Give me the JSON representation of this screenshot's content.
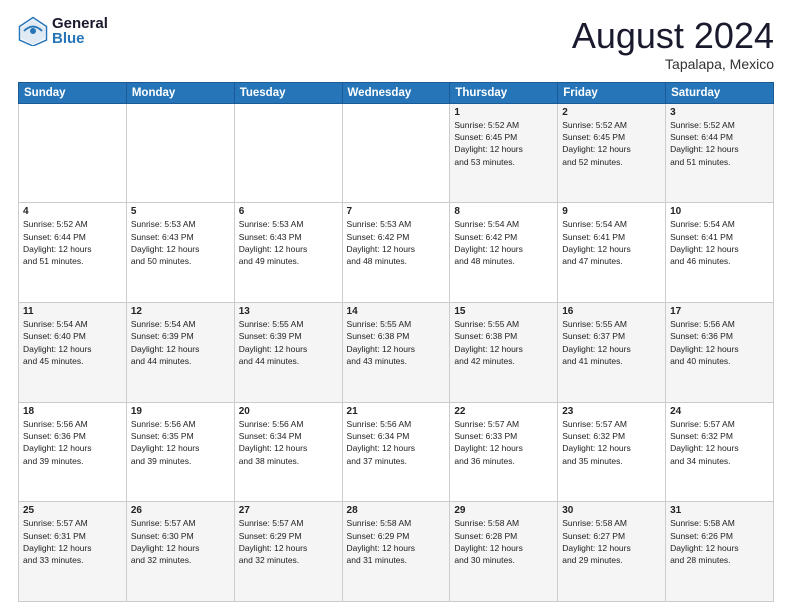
{
  "header": {
    "logo_general": "General",
    "logo_blue": "Blue",
    "month_title": "August 2024",
    "location": "Tapalapa, Mexico"
  },
  "days_of_week": [
    "Sunday",
    "Monday",
    "Tuesday",
    "Wednesday",
    "Thursday",
    "Friday",
    "Saturday"
  ],
  "weeks": [
    {
      "days": [
        {
          "number": "",
          "info": ""
        },
        {
          "number": "",
          "info": ""
        },
        {
          "number": "",
          "info": ""
        },
        {
          "number": "",
          "info": ""
        },
        {
          "number": "1",
          "info": "Sunrise: 5:52 AM\nSunset: 6:45 PM\nDaylight: 12 hours\nand 53 minutes."
        },
        {
          "number": "2",
          "info": "Sunrise: 5:52 AM\nSunset: 6:45 PM\nDaylight: 12 hours\nand 52 minutes."
        },
        {
          "number": "3",
          "info": "Sunrise: 5:52 AM\nSunset: 6:44 PM\nDaylight: 12 hours\nand 51 minutes."
        }
      ]
    },
    {
      "days": [
        {
          "number": "4",
          "info": "Sunrise: 5:52 AM\nSunset: 6:44 PM\nDaylight: 12 hours\nand 51 minutes."
        },
        {
          "number": "5",
          "info": "Sunrise: 5:53 AM\nSunset: 6:43 PM\nDaylight: 12 hours\nand 50 minutes."
        },
        {
          "number": "6",
          "info": "Sunrise: 5:53 AM\nSunset: 6:43 PM\nDaylight: 12 hours\nand 49 minutes."
        },
        {
          "number": "7",
          "info": "Sunrise: 5:53 AM\nSunset: 6:42 PM\nDaylight: 12 hours\nand 48 minutes."
        },
        {
          "number": "8",
          "info": "Sunrise: 5:54 AM\nSunset: 6:42 PM\nDaylight: 12 hours\nand 48 minutes."
        },
        {
          "number": "9",
          "info": "Sunrise: 5:54 AM\nSunset: 6:41 PM\nDaylight: 12 hours\nand 47 minutes."
        },
        {
          "number": "10",
          "info": "Sunrise: 5:54 AM\nSunset: 6:41 PM\nDaylight: 12 hours\nand 46 minutes."
        }
      ]
    },
    {
      "days": [
        {
          "number": "11",
          "info": "Sunrise: 5:54 AM\nSunset: 6:40 PM\nDaylight: 12 hours\nand 45 minutes."
        },
        {
          "number": "12",
          "info": "Sunrise: 5:54 AM\nSunset: 6:39 PM\nDaylight: 12 hours\nand 44 minutes."
        },
        {
          "number": "13",
          "info": "Sunrise: 5:55 AM\nSunset: 6:39 PM\nDaylight: 12 hours\nand 44 minutes."
        },
        {
          "number": "14",
          "info": "Sunrise: 5:55 AM\nSunset: 6:38 PM\nDaylight: 12 hours\nand 43 minutes."
        },
        {
          "number": "15",
          "info": "Sunrise: 5:55 AM\nSunset: 6:38 PM\nDaylight: 12 hours\nand 42 minutes."
        },
        {
          "number": "16",
          "info": "Sunrise: 5:55 AM\nSunset: 6:37 PM\nDaylight: 12 hours\nand 41 minutes."
        },
        {
          "number": "17",
          "info": "Sunrise: 5:56 AM\nSunset: 6:36 PM\nDaylight: 12 hours\nand 40 minutes."
        }
      ]
    },
    {
      "days": [
        {
          "number": "18",
          "info": "Sunrise: 5:56 AM\nSunset: 6:36 PM\nDaylight: 12 hours\nand 39 minutes."
        },
        {
          "number": "19",
          "info": "Sunrise: 5:56 AM\nSunset: 6:35 PM\nDaylight: 12 hours\nand 39 minutes."
        },
        {
          "number": "20",
          "info": "Sunrise: 5:56 AM\nSunset: 6:34 PM\nDaylight: 12 hours\nand 38 minutes."
        },
        {
          "number": "21",
          "info": "Sunrise: 5:56 AM\nSunset: 6:34 PM\nDaylight: 12 hours\nand 37 minutes."
        },
        {
          "number": "22",
          "info": "Sunrise: 5:57 AM\nSunset: 6:33 PM\nDaylight: 12 hours\nand 36 minutes."
        },
        {
          "number": "23",
          "info": "Sunrise: 5:57 AM\nSunset: 6:32 PM\nDaylight: 12 hours\nand 35 minutes."
        },
        {
          "number": "24",
          "info": "Sunrise: 5:57 AM\nSunset: 6:32 PM\nDaylight: 12 hours\nand 34 minutes."
        }
      ]
    },
    {
      "days": [
        {
          "number": "25",
          "info": "Sunrise: 5:57 AM\nSunset: 6:31 PM\nDaylight: 12 hours\nand 33 minutes."
        },
        {
          "number": "26",
          "info": "Sunrise: 5:57 AM\nSunset: 6:30 PM\nDaylight: 12 hours\nand 32 minutes."
        },
        {
          "number": "27",
          "info": "Sunrise: 5:57 AM\nSunset: 6:29 PM\nDaylight: 12 hours\nand 32 minutes."
        },
        {
          "number": "28",
          "info": "Sunrise: 5:58 AM\nSunset: 6:29 PM\nDaylight: 12 hours\nand 31 minutes."
        },
        {
          "number": "29",
          "info": "Sunrise: 5:58 AM\nSunset: 6:28 PM\nDaylight: 12 hours\nand 30 minutes."
        },
        {
          "number": "30",
          "info": "Sunrise: 5:58 AM\nSunset: 6:27 PM\nDaylight: 12 hours\nand 29 minutes."
        },
        {
          "number": "31",
          "info": "Sunrise: 5:58 AM\nSunset: 6:26 PM\nDaylight: 12 hours\nand 28 minutes."
        }
      ]
    }
  ]
}
